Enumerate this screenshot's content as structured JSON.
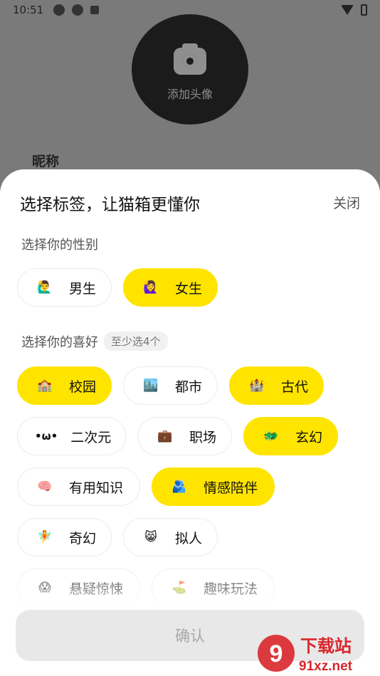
{
  "status": {
    "time": "10:51"
  },
  "background": {
    "avatar_label": "添加头像",
    "nickname_label": "昵称"
  },
  "sheet": {
    "title": "选择标签，让猫箱更懂你",
    "close_label": "关闭",
    "gender_title": "选择你的性别",
    "pref_title": "选择你的喜好",
    "pref_hint": "至少选4个",
    "confirm_label": "确认"
  },
  "gender_chips": [
    {
      "label": "男生",
      "emoji": "🙋‍♂️",
      "selected": false
    },
    {
      "label": "女生",
      "emoji": "🙋‍♀️",
      "selected": true
    }
  ],
  "pref_chips": [
    {
      "label": "校园",
      "emoji": "🏫",
      "selected": true
    },
    {
      "label": "都市",
      "emoji": "🏙️",
      "selected": false
    },
    {
      "label": "古代",
      "emoji": "🏰",
      "selected": true
    },
    {
      "label": "二次元",
      "emoji": "•ω•",
      "selected": false
    },
    {
      "label": "职场",
      "emoji": "💼",
      "selected": false
    },
    {
      "label": "玄幻",
      "emoji": "🐲",
      "selected": true
    },
    {
      "label": "有用知识",
      "emoji": "🧠",
      "selected": false
    },
    {
      "label": "情感陪伴",
      "emoji": "🫂",
      "selected": true
    },
    {
      "label": "奇幻",
      "emoji": "🧚",
      "selected": false
    },
    {
      "label": "拟人",
      "emoji": "😸",
      "selected": false
    },
    {
      "label": "悬疑惊悚",
      "emoji": "😱",
      "selected": false
    },
    {
      "label": "趣味玩法",
      "emoji": "⛳",
      "selected": false
    }
  ],
  "watermark": {
    "text_cn": "下载站",
    "text_url": "91xz.net",
    "logo": "9"
  },
  "colors": {
    "accent_yellow": "#ffe400",
    "confirm_disabled": "#e8e8e8",
    "watermark_red": "#d9262b"
  }
}
